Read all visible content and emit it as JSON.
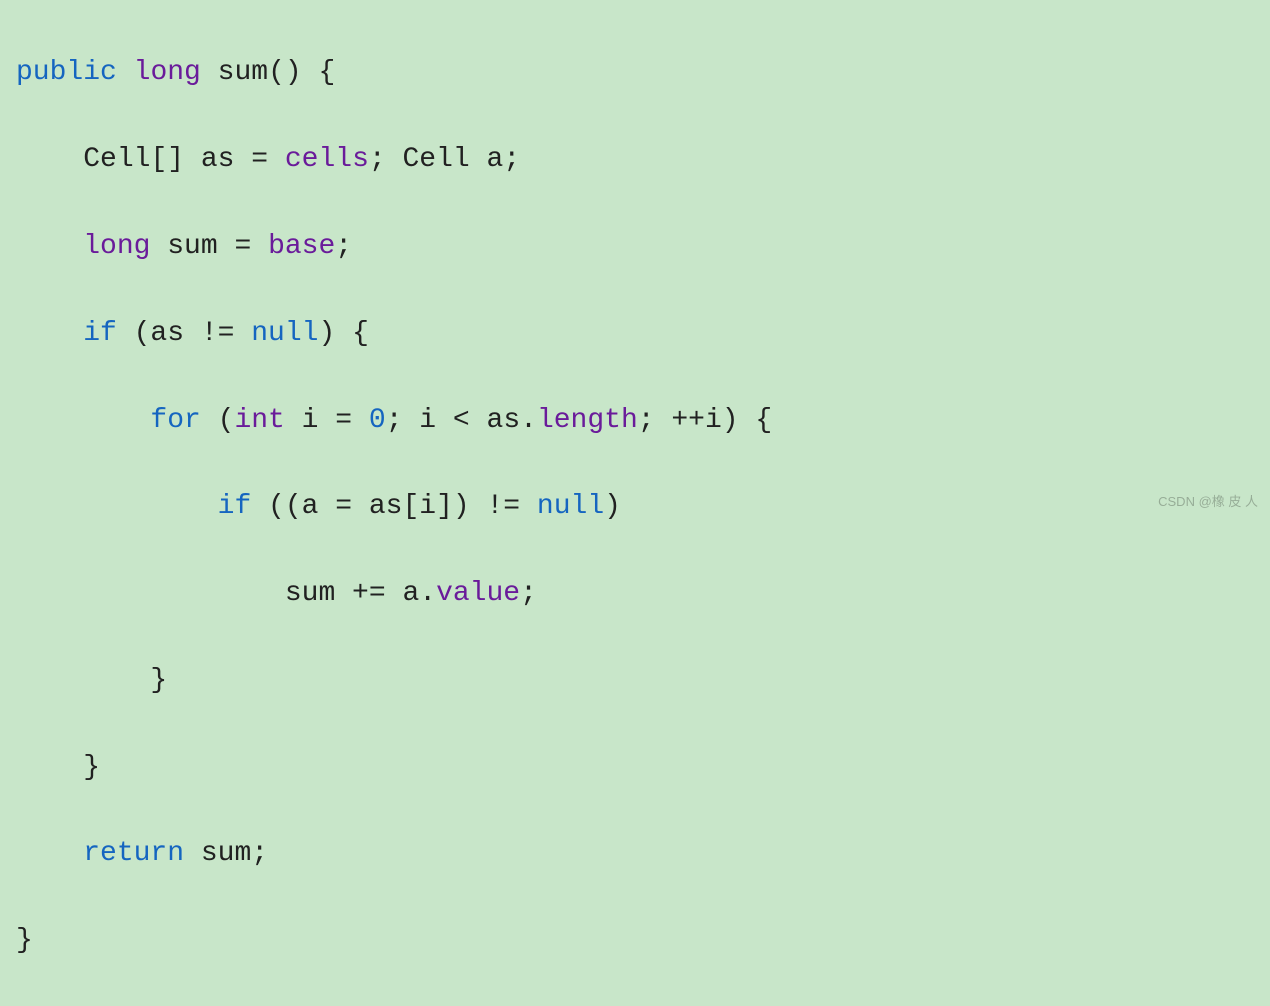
{
  "code": {
    "line1": {
      "kw_public": "public",
      "kw_long": "long",
      "fn_name": "sum",
      "parens": "()",
      "brace": " {"
    },
    "line2": {
      "indent": "    ",
      "type1": "Cell",
      "brackets": "[]",
      "var1": " as ",
      "eq": "= ",
      "field1": "cells",
      "semi1": "; ",
      "type2": "Cell",
      "var2": " a;"
    },
    "line3": {
      "indent": "    ",
      "kw_long": "long",
      "var": " sum ",
      "eq": "= ",
      "field": "base",
      "semi": ";"
    },
    "line4": {
      "indent": "    ",
      "kw_if": "if",
      "open": " (as != ",
      "kw_null": "null",
      "close": ") {"
    },
    "line5": {
      "indent": "        ",
      "kw_for": "for",
      "open": " (",
      "kw_int": "int",
      "var": " i = ",
      "num": "0",
      "mid": "; i < as.",
      "field": "length",
      "post": "; ++i) {"
    },
    "line6": {
      "indent": "            ",
      "kw_if": "if",
      "open": " ((a = as[i]) != ",
      "kw_null": "null",
      "close": ")"
    },
    "line7": {
      "indent": "                ",
      "text1": "sum += a.",
      "field": "value",
      "semi": ";"
    },
    "line8": {
      "indent": "        ",
      "brace": "}"
    },
    "line9": {
      "indent": "    ",
      "brace": "}"
    },
    "line10": {
      "indent": "    ",
      "kw_return": "return",
      "var": " sum;"
    },
    "line11": {
      "brace": "}"
    }
  },
  "watermark": "CSDN @橡 皮 人"
}
